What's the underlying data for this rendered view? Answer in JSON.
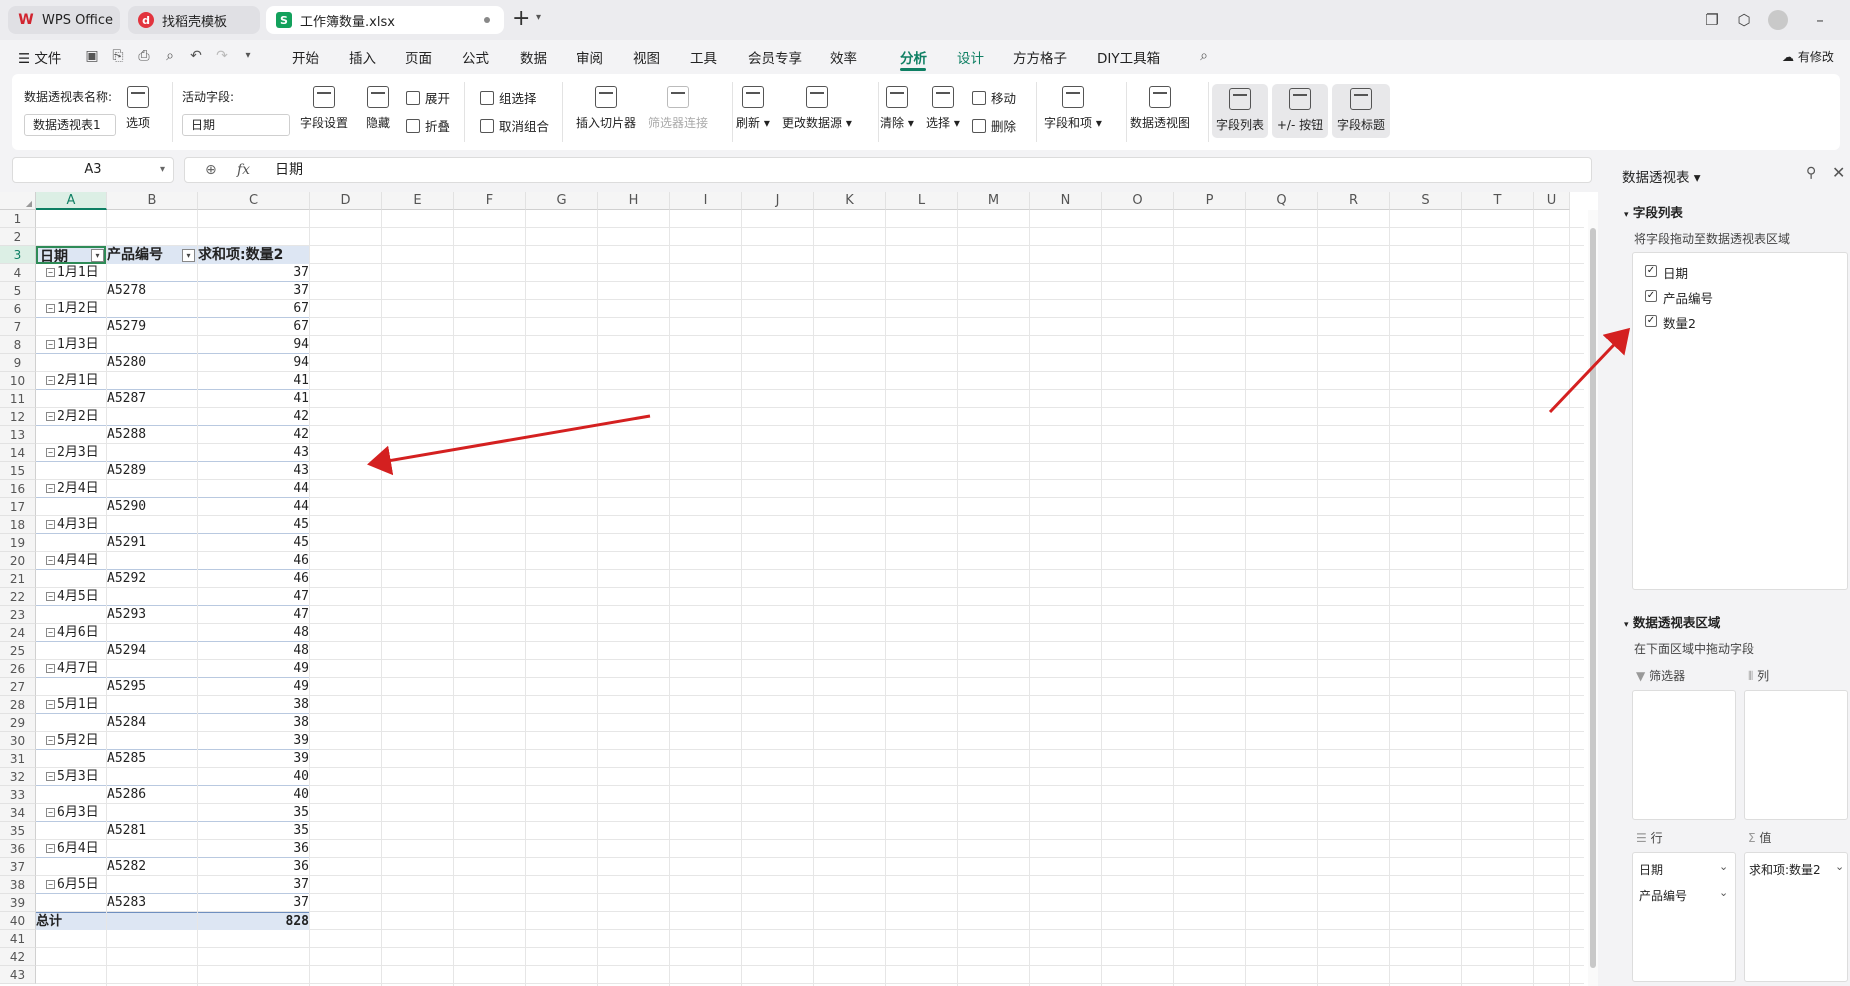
{
  "titlebar": {
    "tabs": [
      {
        "label": "WPS Office",
        "icon": "wps-logo-icon"
      },
      {
        "label": "找稻壳模板",
        "icon": "docer-icon"
      },
      {
        "label": "工作簿数量.xlsx",
        "icon": "spreadsheet-icon"
      }
    ],
    "new_tab": "+"
  },
  "menu": {
    "file": "文件",
    "items": [
      "开始",
      "插入",
      "页面",
      "公式",
      "数据",
      "审阅",
      "视图",
      "工具",
      "会员专享",
      "效率",
      "分析",
      "设计",
      "方方格子",
      "DIY工具箱"
    ],
    "active": "分析",
    "edit_status": "有修改"
  },
  "ribbon": {
    "pivot_name_label": "数据透视表名称:",
    "pivot_name_value": "数据透视表1",
    "options": "选项",
    "active_field_label": "活动字段:",
    "active_field_value": "日期",
    "field_settings": "字段设置",
    "hide": "隐藏",
    "expand": "展开",
    "collapse": "折叠",
    "group_select": "组选择",
    "ungroup": "取消组合",
    "insert_slicer": "插入切片器",
    "filter_connections": "筛选器连接",
    "refresh": "刷新",
    "change_source": "更改数据源",
    "clear": "清除",
    "select": "选择",
    "move": "移动",
    "delete": "删除",
    "fields_items": "字段和项",
    "pivot_chart": "数据透视图",
    "field_list": "字段列表",
    "plus_minus_buttons": "+/- 按钮",
    "field_headers": "字段标题"
  },
  "formula_bar": {
    "name_box": "A3",
    "fx": "fx",
    "content": "日期"
  },
  "sheet": {
    "columns": [
      "A",
      "B",
      "C",
      "D",
      "E",
      "F",
      "G",
      "H",
      "I",
      "J",
      "K",
      "L",
      "M",
      "N",
      "O",
      "P",
      "Q",
      "R",
      "S",
      "T",
      "U"
    ],
    "rows": [
      "1",
      "2",
      "3",
      "4",
      "5",
      "6",
      "7",
      "8",
      "9",
      "10",
      "11",
      "12",
      "13",
      "14",
      "15",
      "16",
      "17",
      "18",
      "19",
      "20",
      "21",
      "22",
      "23",
      "24",
      "25",
      "26",
      "27",
      "28",
      "29",
      "30",
      "31",
      "32",
      "33",
      "34",
      "35",
      "36",
      "37",
      "38",
      "39",
      "40",
      "41",
      "42",
      "43"
    ],
    "pivot_headers": [
      "日期",
      "产品编号",
      "求和项:数量2"
    ],
    "pivot_rows": [
      {
        "a": "1月1日",
        "b": "",
        "c": "37"
      },
      {
        "a": "",
        "b": "A5278",
        "c": "37"
      },
      {
        "a": "1月2日",
        "b": "",
        "c": "67"
      },
      {
        "a": "",
        "b": "A5279",
        "c": "67"
      },
      {
        "a": "1月3日",
        "b": "",
        "c": "94"
      },
      {
        "a": "",
        "b": "A5280",
        "c": "94"
      },
      {
        "a": "2月1日",
        "b": "",
        "c": "41"
      },
      {
        "a": "",
        "b": "A5287",
        "c": "41"
      },
      {
        "a": "2月2日",
        "b": "",
        "c": "42"
      },
      {
        "a": "",
        "b": "A5288",
        "c": "42"
      },
      {
        "a": "2月3日",
        "b": "",
        "c": "43"
      },
      {
        "a": "",
        "b": "A5289",
        "c": "43"
      },
      {
        "a": "2月4日",
        "b": "",
        "c": "44"
      },
      {
        "a": "",
        "b": "A5290",
        "c": "44"
      },
      {
        "a": "4月3日",
        "b": "",
        "c": "45"
      },
      {
        "a": "",
        "b": "A5291",
        "c": "45"
      },
      {
        "a": "4月4日",
        "b": "",
        "c": "46"
      },
      {
        "a": "",
        "b": "A5292",
        "c": "46"
      },
      {
        "a": "4月5日",
        "b": "",
        "c": "47"
      },
      {
        "a": "",
        "b": "A5293",
        "c": "47"
      },
      {
        "a": "4月6日",
        "b": "",
        "c": "48"
      },
      {
        "a": "",
        "b": "A5294",
        "c": "48"
      },
      {
        "a": "4月7日",
        "b": "",
        "c": "49"
      },
      {
        "a": "",
        "b": "A5295",
        "c": "49"
      },
      {
        "a": "5月1日",
        "b": "",
        "c": "38"
      },
      {
        "a": "",
        "b": "A5284",
        "c": "38"
      },
      {
        "a": "5月2日",
        "b": "",
        "c": "39"
      },
      {
        "a": "",
        "b": "A5285",
        "c": "39"
      },
      {
        "a": "5月3日",
        "b": "",
        "c": "40"
      },
      {
        "a": "",
        "b": "A5286",
        "c": "40"
      },
      {
        "a": "6月3日",
        "b": "",
        "c": "35"
      },
      {
        "a": "",
        "b": "A5281",
        "c": "35"
      },
      {
        "a": "6月4日",
        "b": "",
        "c": "36"
      },
      {
        "a": "",
        "b": "A5282",
        "c": "36"
      },
      {
        "a": "6月5日",
        "b": "",
        "c": "37"
      },
      {
        "a": "",
        "b": "A5283",
        "c": "37"
      }
    ],
    "total_label": "总计",
    "total_value": "828"
  },
  "panel": {
    "title": "数据透视表",
    "field_list_title": "字段列表",
    "field_list_hint": "将字段拖动至数据透视表区域",
    "fields": [
      {
        "label": "日期",
        "checked": true
      },
      {
        "label": "产品编号",
        "checked": true
      },
      {
        "label": "数量2",
        "checked": true
      }
    ],
    "areas_title": "数据透视表区域",
    "areas_hint": "在下面区域中拖动字段",
    "filter_label": "筛选器",
    "columns_label": "列",
    "rows_label": "行",
    "values_label": "值",
    "row_fields": [
      "日期",
      "产品编号"
    ],
    "value_fields": [
      "求和项:数量2"
    ]
  },
  "annotation_color": "#d42020"
}
